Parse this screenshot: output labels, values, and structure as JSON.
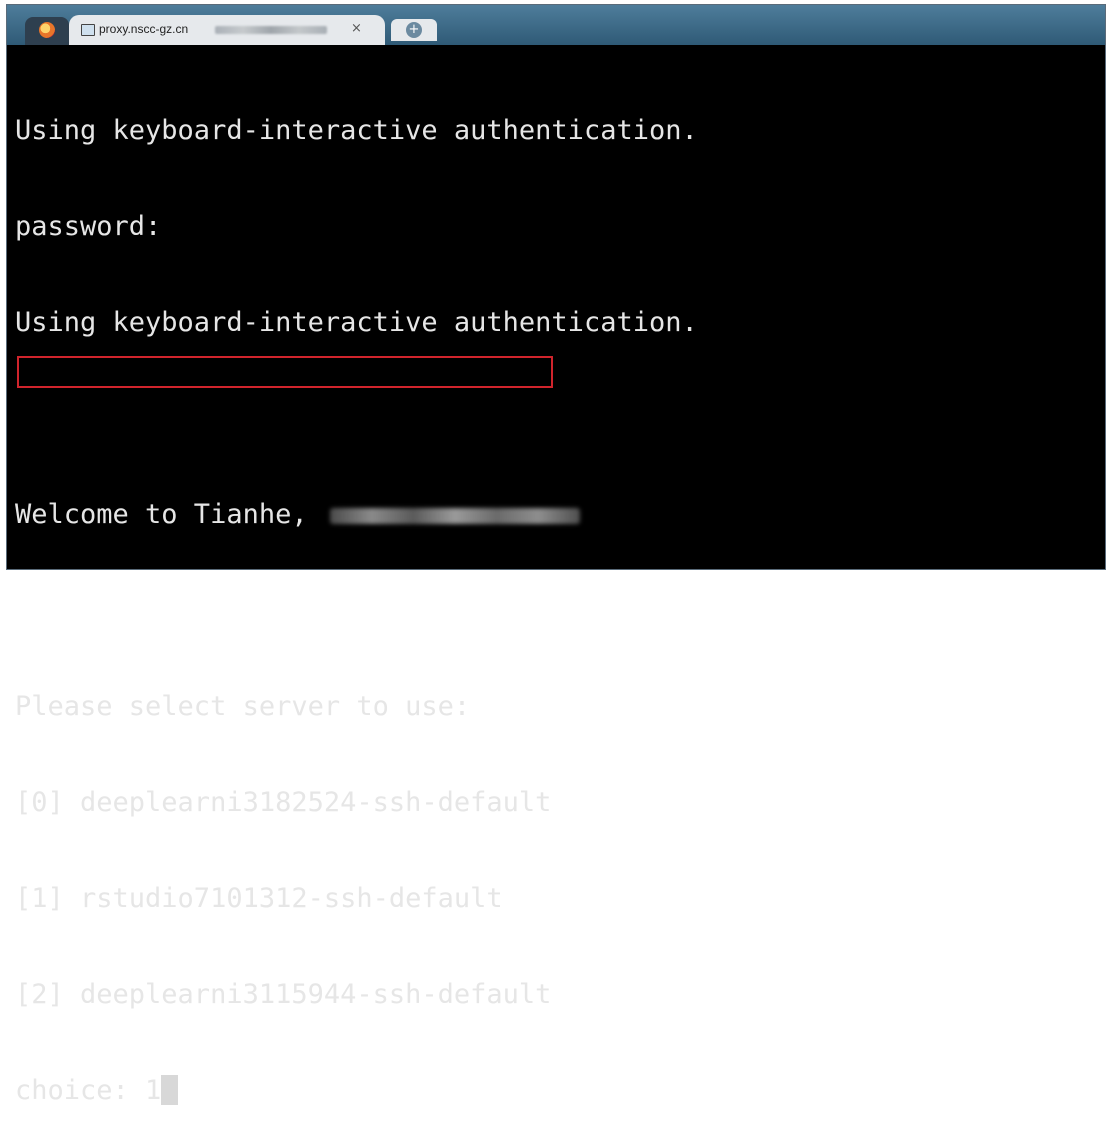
{
  "window": {
    "tab_title": "proxy.nscc-gz.cn",
    "close_glyph": "×",
    "new_tab_glyph": "+"
  },
  "terminal": {
    "line1": "Using keyboard-interactive authentication.",
    "line2": "password:",
    "line3": "Using keyboard-interactive authentication.",
    "welcome": "Welcome to Tianhe, ",
    "prompt": "Please select server to use:",
    "servers": [
      "[0] deeplearni3182524-ssh-default",
      "[1] rstudio7101312-ssh-default",
      "[2] deeplearni3115944-ssh-default"
    ],
    "choice_label": "choice: ",
    "choice_value": "1"
  },
  "colors": {
    "highlight": "#d0242c",
    "terminal_bg": "#000000",
    "terminal_fg": "#e6e6e6"
  }
}
